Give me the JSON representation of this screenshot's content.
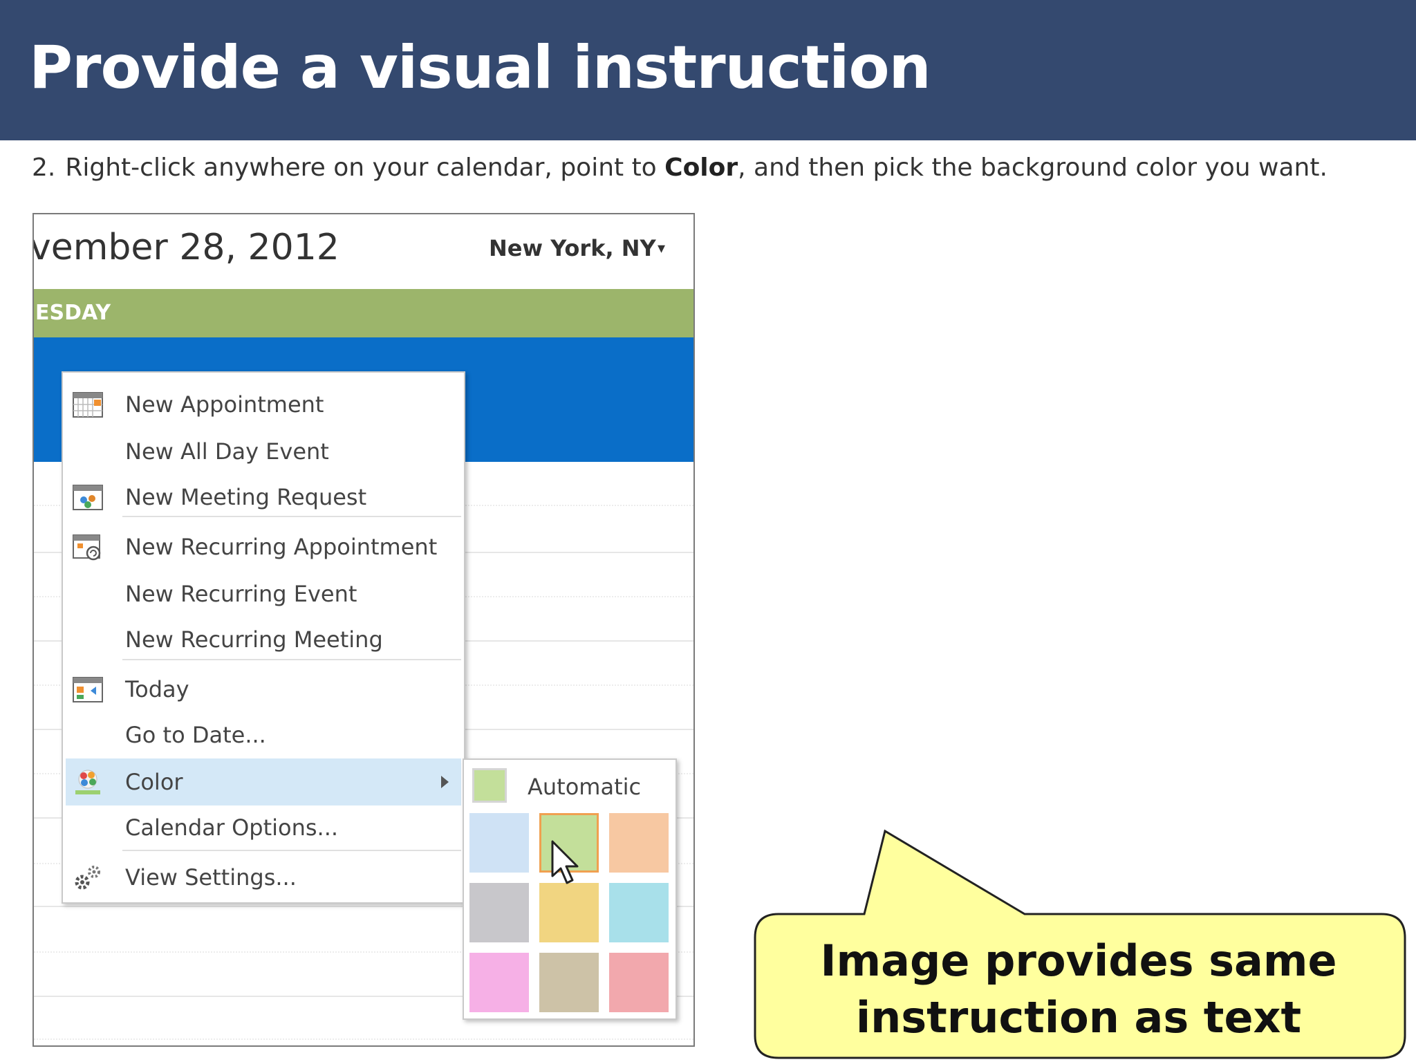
{
  "slide": {
    "title": "Provide a visual instruction",
    "instruction": {
      "number": "2.",
      "before": "Right-click anywhere on your calendar, point to ",
      "bold": "Color",
      "after": ", and then pick the background color you want."
    }
  },
  "calendar": {
    "date": "vember 28, 2012",
    "location": "New York, NY",
    "day_name": "ESDAY",
    "colors": {
      "day_band": "#9cb56b",
      "selected_slot": "#0a6ec8"
    }
  },
  "context_menu": {
    "items": [
      {
        "label": "New Appointment",
        "icon": "calendar-appointment-icon"
      },
      {
        "label": "New All Day Event",
        "icon": ""
      },
      {
        "label": "New Meeting Request",
        "icon": "meeting-request-icon"
      },
      {
        "label": "New Recurring Appointment",
        "icon": "recurring-appointment-icon"
      },
      {
        "label": "New Recurring Event",
        "icon": ""
      },
      {
        "label": "New Recurring Meeting",
        "icon": ""
      },
      {
        "label": "Today",
        "icon": "today-icon"
      },
      {
        "label": "Go to Date...",
        "icon": ""
      },
      {
        "label": "Color",
        "icon": "color-palette-icon",
        "highlighted": true,
        "has_submenu": true
      },
      {
        "label": "Calendar Options...",
        "icon": ""
      },
      {
        "label": "View Settings...",
        "icon": "settings-gears-icon"
      }
    ]
  },
  "color_menu": {
    "automatic_label": "Automatic",
    "automatic_color": "#c3df9a",
    "swatches": [
      "#cfe2f5",
      "#c3df9a",
      "#f7c8a2",
      "#c8c7cb",
      "#f1d581",
      "#a8e0ea",
      "#f6b0e6",
      "#cdc2a7",
      "#f2a8ad"
    ],
    "selected_index": 1
  },
  "callout": {
    "line1": "Image provides same",
    "line2": "instruction as text",
    "fill": "#ffff9e"
  }
}
